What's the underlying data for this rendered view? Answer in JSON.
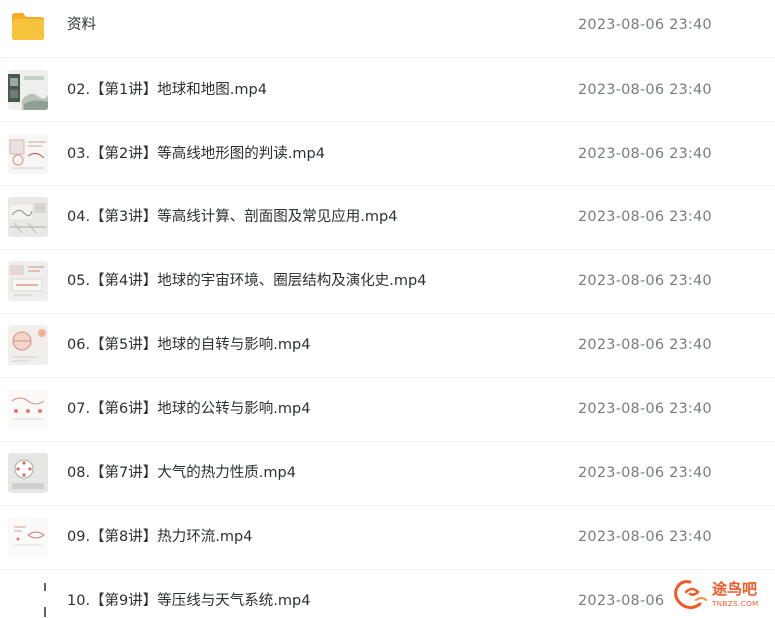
{
  "files": [
    {
      "name": "资料",
      "date": "2023-08-06 23:40",
      "icon": "folder-icon",
      "type": "folder"
    },
    {
      "name": "02.【第1讲】地球和地图.mp4",
      "date": "2023-08-06 23:40",
      "icon": "video-thumbnail-icon",
      "type": "video"
    },
    {
      "name": "03.【第2讲】等高线地形图的判读.mp4",
      "date": "2023-08-06 23:40",
      "icon": "video-thumbnail-icon",
      "type": "video"
    },
    {
      "name": "04.【第3讲】等高线计算、剖面图及常见应用.mp4",
      "date": "2023-08-06 23:40",
      "icon": "video-thumbnail-icon",
      "type": "video"
    },
    {
      "name": "05.【第4讲】地球的宇宙环境、圈层结构及演化史.mp4",
      "date": "2023-08-06 23:40",
      "icon": "video-thumbnail-icon",
      "type": "video"
    },
    {
      "name": "06.【第5讲】地球的自转与影响.mp4",
      "date": "2023-08-06 23:40",
      "icon": "video-thumbnail-icon",
      "type": "video"
    },
    {
      "name": "07.【第6讲】地球的公转与影响.mp4",
      "date": "2023-08-06 23:40",
      "icon": "video-thumbnail-icon",
      "type": "video"
    },
    {
      "name": "08.【第7讲】大气的热力性质.mp4",
      "date": "2023-08-06 23:40",
      "icon": "video-thumbnail-icon",
      "type": "video"
    },
    {
      "name": "09.【第8讲】热力环流.mp4",
      "date": "2023-08-06 23:40",
      "icon": "video-thumbnail-icon",
      "type": "video"
    },
    {
      "name": "10.【第9讲】等压线与天气系统.mp4",
      "date": "2023-08-06",
      "icon": "video-thumbnail-icon",
      "type": "video"
    }
  ],
  "watermark": {
    "text": "途鸟吧",
    "url": "TNBZS.COM",
    "icon": "bird-logo-icon"
  },
  "colors": {
    "folder": "#f7c33d",
    "name_text": "#2b2f36",
    "date_text": "#777d86",
    "divider": "#eceef2",
    "watermark": "#f05a28"
  }
}
